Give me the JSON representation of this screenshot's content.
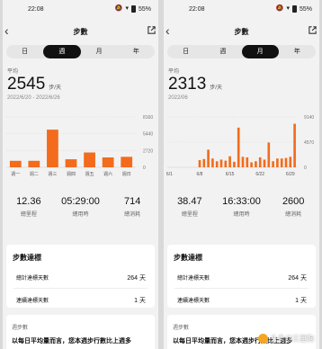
{
  "accent": "#f36b1c",
  "panels": [
    {
      "status": {
        "time": "22:08",
        "battery": "55%"
      },
      "title": "步數",
      "tabs": [
        {
          "label": "日",
          "active": false
        },
        {
          "label": "週",
          "active": true
        },
        {
          "label": "月",
          "active": false
        },
        {
          "label": "年",
          "active": false
        }
      ],
      "avg_label": "平均",
      "avg_value": "2545",
      "avg_unit": "步/天",
      "date_range": "2022/6/20 - 2022/6/26",
      "chart_data": {
        "type": "bar",
        "categories": [
          "週一",
          "週二",
          "週三",
          "週四",
          "週五",
          "週六",
          "週日"
        ],
        "values": [
          1050,
          1050,
          6100,
          1300,
          2400,
          1600,
          1700
        ],
        "y_ticks": [
          "8160",
          "5440",
          "2720",
          "0"
        ],
        "ylim": [
          0,
          8160
        ],
        "grid": true
      },
      "stats": [
        {
          "value": "12.36",
          "label": "總里程"
        },
        {
          "value": "05:29:00",
          "label": "總用時"
        },
        {
          "value": "714",
          "label": "總消耗"
        }
      ],
      "goal_card": {
        "title": "步數達標",
        "rows": [
          {
            "label": "總計達標天數",
            "value": "264 天"
          },
          {
            "label": "連續達標天數",
            "value": "1 天"
          }
        ]
      },
      "summary_card": {
        "label": "週步數",
        "message": "以每日平均量而言，您本週步行數比上週多"
      }
    },
    {
      "status": {
        "time": "22:08",
        "battery": "55%"
      },
      "title": "步數",
      "tabs": [
        {
          "label": "日",
          "active": false
        },
        {
          "label": "週",
          "active": false
        },
        {
          "label": "月",
          "active": true
        },
        {
          "label": "年",
          "active": false
        }
      ],
      "avg_label": "平均",
      "avg_value": "2313",
      "avg_unit": "步/天",
      "date_range": "2022/06",
      "chart_data": {
        "type": "bar",
        "categories": [
          "6/1",
          "6/2",
          "6/3",
          "6/4",
          "6/5",
          "6/6",
          "6/7",
          "6/8",
          "6/9",
          "6/10",
          "6/11",
          "6/12",
          "6/13",
          "6/14",
          "6/15",
          "6/16",
          "6/17",
          "6/18",
          "6/19",
          "6/20",
          "6/21",
          "6/22",
          "6/23",
          "6/24",
          "6/25",
          "6/26",
          "6/27",
          "6/28",
          "6/29",
          "6/30"
        ],
        "values": [
          0,
          0,
          0,
          0,
          0,
          0,
          0,
          1300,
          1500,
          3200,
          1600,
          1100,
          1400,
          1200,
          2000,
          1000,
          7200,
          1900,
          1800,
          900,
          1100,
          1800,
          1400,
          4500,
          1100,
          1600,
          1600,
          1700,
          1900,
          7900
        ],
        "x_tick_labels": [
          "6/1",
          "6/8",
          "6/15",
          "6/22",
          "6/29"
        ],
        "y_ticks": [
          "9140",
          "4570",
          "0"
        ],
        "ylim": [
          0,
          9140
        ],
        "grid": true
      },
      "stats": [
        {
          "value": "38.47",
          "label": "總里程"
        },
        {
          "value": "16:33:00",
          "label": "總用時"
        },
        {
          "value": "2600",
          "label": "總消耗"
        }
      ],
      "goal_card": {
        "title": "步數達標",
        "rows": [
          {
            "label": "總計達標天數",
            "value": "264 天"
          },
          {
            "label": "連續達標天數",
            "value": "1 天"
          }
        ]
      },
      "summary_card": {
        "label": "週步數",
        "message": "以每日平均量而言，您本週步行數比上週多"
      },
      "watermark": "头条@三里狗"
    }
  ]
}
